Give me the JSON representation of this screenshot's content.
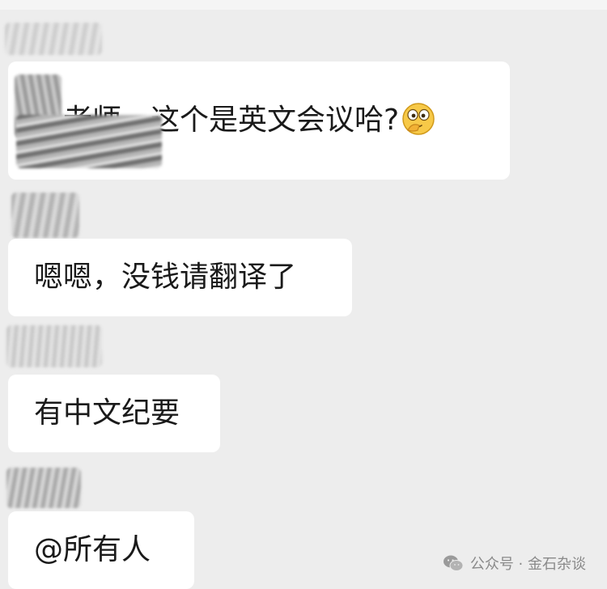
{
  "chat": {
    "messages": [
      {
        "text": "老师，这个是英文会议哈?",
        "emoji": "thinking-face-emoji"
      },
      {
        "text": "嗯嗯，没钱请翻译了"
      },
      {
        "text": "有中文纪要"
      },
      {
        "text": "@所有人"
      }
    ]
  },
  "watermark": {
    "icon": "wechat-icon",
    "text": "公众号 · 金石杂谈"
  },
  "colors": {
    "background": "#ededed",
    "bubble": "#ffffff",
    "text": "#1a1a1a",
    "watermark": "#8a8a8a"
  }
}
